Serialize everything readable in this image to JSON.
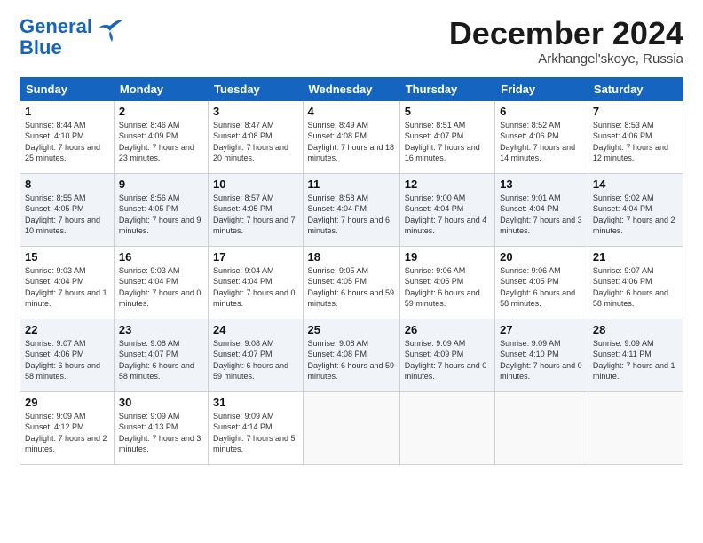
{
  "header": {
    "logo_line1": "General",
    "logo_line2": "Blue",
    "month": "December 2024",
    "location": "Arkhangel'skoye, Russia"
  },
  "weekdays": [
    "Sunday",
    "Monday",
    "Tuesday",
    "Wednesday",
    "Thursday",
    "Friday",
    "Saturday"
  ],
  "weeks": [
    [
      {
        "day": "1",
        "sunrise": "Sunrise: 8:44 AM",
        "sunset": "Sunset: 4:10 PM",
        "daylight": "Daylight: 7 hours and 25 minutes."
      },
      {
        "day": "2",
        "sunrise": "Sunrise: 8:46 AM",
        "sunset": "Sunset: 4:09 PM",
        "daylight": "Daylight: 7 hours and 23 minutes."
      },
      {
        "day": "3",
        "sunrise": "Sunrise: 8:47 AM",
        "sunset": "Sunset: 4:08 PM",
        "daylight": "Daylight: 7 hours and 20 minutes."
      },
      {
        "day": "4",
        "sunrise": "Sunrise: 8:49 AM",
        "sunset": "Sunset: 4:08 PM",
        "daylight": "Daylight: 7 hours and 18 minutes."
      },
      {
        "day": "5",
        "sunrise": "Sunrise: 8:51 AM",
        "sunset": "Sunset: 4:07 PM",
        "daylight": "Daylight: 7 hours and 16 minutes."
      },
      {
        "day": "6",
        "sunrise": "Sunrise: 8:52 AM",
        "sunset": "Sunset: 4:06 PM",
        "daylight": "Daylight: 7 hours and 14 minutes."
      },
      {
        "day": "7",
        "sunrise": "Sunrise: 8:53 AM",
        "sunset": "Sunset: 4:06 PM",
        "daylight": "Daylight: 7 hours and 12 minutes."
      }
    ],
    [
      {
        "day": "8",
        "sunrise": "Sunrise: 8:55 AM",
        "sunset": "Sunset: 4:05 PM",
        "daylight": "Daylight: 7 hours and 10 minutes."
      },
      {
        "day": "9",
        "sunrise": "Sunrise: 8:56 AM",
        "sunset": "Sunset: 4:05 PM",
        "daylight": "Daylight: 7 hours and 9 minutes."
      },
      {
        "day": "10",
        "sunrise": "Sunrise: 8:57 AM",
        "sunset": "Sunset: 4:05 PM",
        "daylight": "Daylight: 7 hours and 7 minutes."
      },
      {
        "day": "11",
        "sunrise": "Sunrise: 8:58 AM",
        "sunset": "Sunset: 4:04 PM",
        "daylight": "Daylight: 7 hours and 6 minutes."
      },
      {
        "day": "12",
        "sunrise": "Sunrise: 9:00 AM",
        "sunset": "Sunset: 4:04 PM",
        "daylight": "Daylight: 7 hours and 4 minutes."
      },
      {
        "day": "13",
        "sunrise": "Sunrise: 9:01 AM",
        "sunset": "Sunset: 4:04 PM",
        "daylight": "Daylight: 7 hours and 3 minutes."
      },
      {
        "day": "14",
        "sunrise": "Sunrise: 9:02 AM",
        "sunset": "Sunset: 4:04 PM",
        "daylight": "Daylight: 7 hours and 2 minutes."
      }
    ],
    [
      {
        "day": "15",
        "sunrise": "Sunrise: 9:03 AM",
        "sunset": "Sunset: 4:04 PM",
        "daylight": "Daylight: 7 hours and 1 minute."
      },
      {
        "day": "16",
        "sunrise": "Sunrise: 9:03 AM",
        "sunset": "Sunset: 4:04 PM",
        "daylight": "Daylight: 7 hours and 0 minutes."
      },
      {
        "day": "17",
        "sunrise": "Sunrise: 9:04 AM",
        "sunset": "Sunset: 4:04 PM",
        "daylight": "Daylight: 7 hours and 0 minutes."
      },
      {
        "day": "18",
        "sunrise": "Sunrise: 9:05 AM",
        "sunset": "Sunset: 4:05 PM",
        "daylight": "Daylight: 6 hours and 59 minutes."
      },
      {
        "day": "19",
        "sunrise": "Sunrise: 9:06 AM",
        "sunset": "Sunset: 4:05 PM",
        "daylight": "Daylight: 6 hours and 59 minutes."
      },
      {
        "day": "20",
        "sunrise": "Sunrise: 9:06 AM",
        "sunset": "Sunset: 4:05 PM",
        "daylight": "Daylight: 6 hours and 58 minutes."
      },
      {
        "day": "21",
        "sunrise": "Sunrise: 9:07 AM",
        "sunset": "Sunset: 4:06 PM",
        "daylight": "Daylight: 6 hours and 58 minutes."
      }
    ],
    [
      {
        "day": "22",
        "sunrise": "Sunrise: 9:07 AM",
        "sunset": "Sunset: 4:06 PM",
        "daylight": "Daylight: 6 hours and 58 minutes."
      },
      {
        "day": "23",
        "sunrise": "Sunrise: 9:08 AM",
        "sunset": "Sunset: 4:07 PM",
        "daylight": "Daylight: 6 hours and 58 minutes."
      },
      {
        "day": "24",
        "sunrise": "Sunrise: 9:08 AM",
        "sunset": "Sunset: 4:07 PM",
        "daylight": "Daylight: 6 hours and 59 minutes."
      },
      {
        "day": "25",
        "sunrise": "Sunrise: 9:08 AM",
        "sunset": "Sunset: 4:08 PM",
        "daylight": "Daylight: 6 hours and 59 minutes."
      },
      {
        "day": "26",
        "sunrise": "Sunrise: 9:09 AM",
        "sunset": "Sunset: 4:09 PM",
        "daylight": "Daylight: 7 hours and 0 minutes."
      },
      {
        "day": "27",
        "sunrise": "Sunrise: 9:09 AM",
        "sunset": "Sunset: 4:10 PM",
        "daylight": "Daylight: 7 hours and 0 minutes."
      },
      {
        "day": "28",
        "sunrise": "Sunrise: 9:09 AM",
        "sunset": "Sunset: 4:11 PM",
        "daylight": "Daylight: 7 hours and 1 minute."
      }
    ],
    [
      {
        "day": "29",
        "sunrise": "Sunrise: 9:09 AM",
        "sunset": "Sunset: 4:12 PM",
        "daylight": "Daylight: 7 hours and 2 minutes."
      },
      {
        "day": "30",
        "sunrise": "Sunrise: 9:09 AM",
        "sunset": "Sunset: 4:13 PM",
        "daylight": "Daylight: 7 hours and 3 minutes."
      },
      {
        "day": "31",
        "sunrise": "Sunrise: 9:09 AM",
        "sunset": "Sunset: 4:14 PM",
        "daylight": "Daylight: 7 hours and 5 minutes."
      },
      null,
      null,
      null,
      null
    ]
  ]
}
